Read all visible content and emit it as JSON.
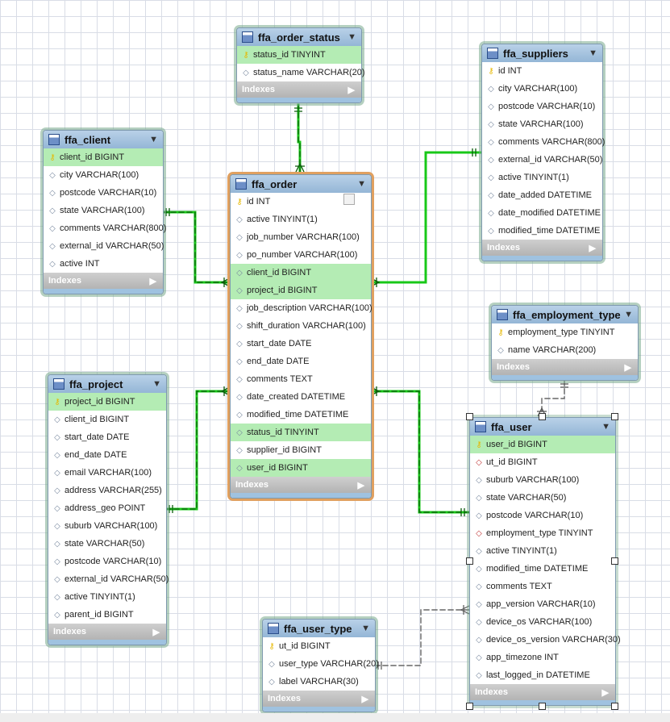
{
  "tables": [
    {
      "name": "ffa_order_status",
      "columns": [
        {
          "label": "status_id TINYINT",
          "type": "pk",
          "hl": true
        },
        {
          "label": "status_name VARCHAR(20)",
          "type": "col",
          "hl": false
        }
      ],
      "indexes": "Indexes"
    },
    {
      "name": "ffa_suppliers",
      "columns": [
        {
          "label": "id INT",
          "type": "pk",
          "hl": false
        },
        {
          "label": "city VARCHAR(100)",
          "type": "col",
          "hl": false
        },
        {
          "label": "postcode VARCHAR(10)",
          "type": "col",
          "hl": false
        },
        {
          "label": "state VARCHAR(100)",
          "type": "col",
          "hl": false
        },
        {
          "label": "comments VARCHAR(800)",
          "type": "col",
          "hl": false
        },
        {
          "label": "external_id VARCHAR(50)",
          "type": "col",
          "hl": false
        },
        {
          "label": "active TINYINT(1)",
          "type": "col",
          "hl": false
        },
        {
          "label": "date_added DATETIME",
          "type": "col",
          "hl": false
        },
        {
          "label": "date_modified DATETIME",
          "type": "col",
          "hl": false
        },
        {
          "label": "modified_time DATETIME",
          "type": "col",
          "hl": false
        }
      ],
      "indexes": "Indexes"
    },
    {
      "name": "ffa_client",
      "columns": [
        {
          "label": "client_id BIGINT",
          "type": "pk",
          "hl": true
        },
        {
          "label": "city VARCHAR(100)",
          "type": "col",
          "hl": false
        },
        {
          "label": "postcode VARCHAR(10)",
          "type": "col",
          "hl": false
        },
        {
          "label": "state VARCHAR(100)",
          "type": "col",
          "hl": false
        },
        {
          "label": "comments VARCHAR(800)",
          "type": "col",
          "hl": false
        },
        {
          "label": "external_id VARCHAR(50)",
          "type": "col",
          "hl": false
        },
        {
          "label": "active INT",
          "type": "col",
          "hl": false
        }
      ],
      "indexes": "Indexes"
    },
    {
      "name": "ffa_order",
      "columns": [
        {
          "label": "id INT",
          "type": "pk",
          "hl": false
        },
        {
          "label": "active TINYINT(1)",
          "type": "col",
          "hl": false
        },
        {
          "label": "job_number VARCHAR(100)",
          "type": "col",
          "hl": false
        },
        {
          "label": "po_number VARCHAR(100)",
          "type": "col",
          "hl": false
        },
        {
          "label": "client_id BIGINT",
          "type": "col",
          "hl": true
        },
        {
          "label": "project_id BIGINT",
          "type": "col",
          "hl": true
        },
        {
          "label": "job_description VARCHAR(100)",
          "type": "col",
          "hl": false
        },
        {
          "label": "shift_duration VARCHAR(100)",
          "type": "col",
          "hl": false
        },
        {
          "label": "start_date DATE",
          "type": "col",
          "hl": false
        },
        {
          "label": "end_date DATE",
          "type": "col",
          "hl": false
        },
        {
          "label": "comments TEXT",
          "type": "col",
          "hl": false
        },
        {
          "label": "date_created DATETIME",
          "type": "col",
          "hl": false
        },
        {
          "label": "modified_time DATETIME",
          "type": "col",
          "hl": false
        },
        {
          "label": "status_id TINYINT",
          "type": "col",
          "hl": true
        },
        {
          "label": "supplier_id BIGINT",
          "type": "col",
          "hl": false
        },
        {
          "label": "user_id BIGINT",
          "type": "col",
          "hl": true
        }
      ],
      "indexes": "Indexes"
    },
    {
      "name": "ffa_employment_type",
      "columns": [
        {
          "label": "employment_type TINYINT",
          "type": "pk",
          "hl": false
        },
        {
          "label": "name VARCHAR(200)",
          "type": "col",
          "hl": false
        }
      ],
      "indexes": "Indexes"
    },
    {
      "name": "ffa_project",
      "columns": [
        {
          "label": "project_id BIGINT",
          "type": "pk",
          "hl": true
        },
        {
          "label": "client_id BIGINT",
          "type": "col",
          "hl": false
        },
        {
          "label": "start_date DATE",
          "type": "col",
          "hl": false
        },
        {
          "label": "end_date DATE",
          "type": "col",
          "hl": false
        },
        {
          "label": "email VARCHAR(100)",
          "type": "col",
          "hl": false
        },
        {
          "label": "address VARCHAR(255)",
          "type": "col",
          "hl": false
        },
        {
          "label": "address_geo POINT",
          "type": "col",
          "hl": false
        },
        {
          "label": "suburb VARCHAR(100)",
          "type": "col",
          "hl": false
        },
        {
          "label": "state VARCHAR(50)",
          "type": "col",
          "hl": false
        },
        {
          "label": "postcode VARCHAR(10)",
          "type": "col",
          "hl": false
        },
        {
          "label": "external_id VARCHAR(50)",
          "type": "col",
          "hl": false
        },
        {
          "label": "active TINYINT(1)",
          "type": "col",
          "hl": false
        },
        {
          "label": "parent_id BIGINT",
          "type": "col",
          "hl": false
        }
      ],
      "indexes": "Indexes"
    },
    {
      "name": "ffa_user",
      "columns": [
        {
          "label": "user_id BIGINT",
          "type": "pk",
          "hl": true
        },
        {
          "label": "ut_id BIGINT",
          "type": "fk",
          "hl": false
        },
        {
          "label": "suburb VARCHAR(100)",
          "type": "col",
          "hl": false
        },
        {
          "label": "state VARCHAR(50)",
          "type": "col",
          "hl": false
        },
        {
          "label": "postcode VARCHAR(10)",
          "type": "col",
          "hl": false
        },
        {
          "label": "employment_type TINYINT",
          "type": "fk",
          "hl": false
        },
        {
          "label": "active TINYINT(1)",
          "type": "col",
          "hl": false
        },
        {
          "label": "modified_time DATETIME",
          "type": "col",
          "hl": false
        },
        {
          "label": "comments TEXT",
          "type": "col",
          "hl": false
        },
        {
          "label": "app_version VARCHAR(10)",
          "type": "col",
          "hl": false
        },
        {
          "label": "device_os VARCHAR(100)",
          "type": "col",
          "hl": false
        },
        {
          "label": "device_os_version VARCHAR(30)",
          "type": "col",
          "hl": false
        },
        {
          "label": "app_timezone INT",
          "type": "col",
          "hl": false
        },
        {
          "label": "last_logged_in DATETIME",
          "type": "col",
          "hl": false
        }
      ],
      "indexes": "Indexes"
    },
    {
      "name": "ffa_user_type",
      "columns": [
        {
          "label": "ut_id BIGINT",
          "type": "pk",
          "hl": false
        },
        {
          "label": "user_type VARCHAR(20)",
          "type": "col",
          "hl": false
        },
        {
          "label": "label VARCHAR(30)",
          "type": "col",
          "hl": false
        }
      ],
      "indexes": "Indexes"
    }
  ],
  "status_bar": "",
  "colors": {
    "link": "#18c818",
    "link_dark": "#0a5a0a",
    "dashed": "#666666",
    "selected_border": "#e0a060",
    "highlight_row": "#b4ecb4"
  },
  "icons": {
    "table": "table-icon",
    "primary_key": "key-icon",
    "column": "diamond-icon",
    "foreign_key": "foreign-key-icon",
    "expand": "chevron-down-icon",
    "indexes_arrow": "triangle-right-icon"
  }
}
